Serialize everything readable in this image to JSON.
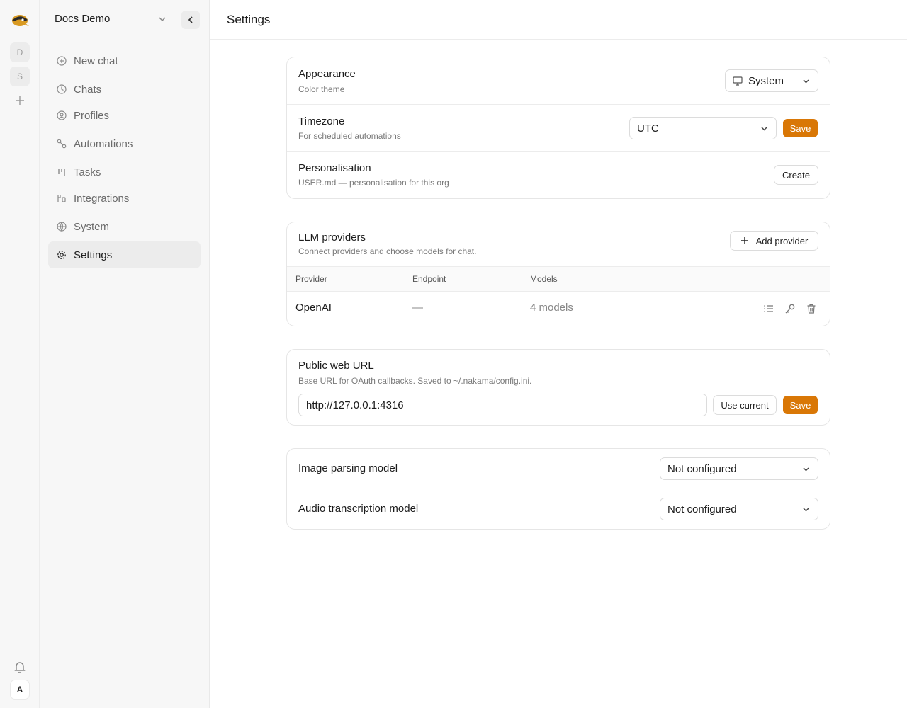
{
  "rail": {
    "workspaces": [
      "D",
      "S"
    ],
    "avatar": "A"
  },
  "sidebar": {
    "org_name": "Docs Demo",
    "items": [
      {
        "label": "New chat",
        "icon": "plus-circle-icon"
      },
      {
        "label": "Chats",
        "icon": "clock-icon"
      },
      {
        "label": "Profiles",
        "icon": "user-circle-icon"
      },
      {
        "label": "Automations",
        "icon": "workflow-icon"
      },
      {
        "label": "Tasks",
        "icon": "kanban-icon"
      },
      {
        "label": "Integrations",
        "icon": "plug-icon"
      },
      {
        "label": "System",
        "icon": "globe-icon"
      },
      {
        "label": "Settings",
        "icon": "gear-icon",
        "active": true
      }
    ]
  },
  "header": {
    "title": "Settings"
  },
  "general": {
    "appearance": {
      "title": "Appearance",
      "subtitle": "Color theme",
      "value": "System"
    },
    "timezone": {
      "title": "Timezone",
      "subtitle": "For scheduled automations",
      "value": "UTC",
      "save_label": "Save"
    },
    "personalisation": {
      "title": "Personalisation",
      "subtitle": "USER.md — personalisation for this org",
      "create_label": "Create"
    }
  },
  "llm": {
    "title": "LLM providers",
    "subtitle": "Connect providers and choose models for chat.",
    "add_label": "Add provider",
    "columns": [
      "Provider",
      "Endpoint",
      "Models"
    ],
    "rows": [
      {
        "provider": "OpenAI",
        "endpoint": "—",
        "models": "4 models"
      }
    ]
  },
  "public_url": {
    "title": "Public web URL",
    "subtitle": "Base URL for OAuth callbacks. Saved to ~/.nakama/config.ini.",
    "value": "http://127.0.0.1:4316",
    "use_current_label": "Use current",
    "save_label": "Save"
  },
  "models": {
    "image": {
      "title": "Image parsing model",
      "value": "Not configured"
    },
    "audio": {
      "title": "Audio transcription model",
      "value": "Not configured"
    }
  },
  "colors": {
    "accent": "#d97706",
    "sidebar_bg": "#f7f7f7",
    "border": "#e6e6e6"
  }
}
